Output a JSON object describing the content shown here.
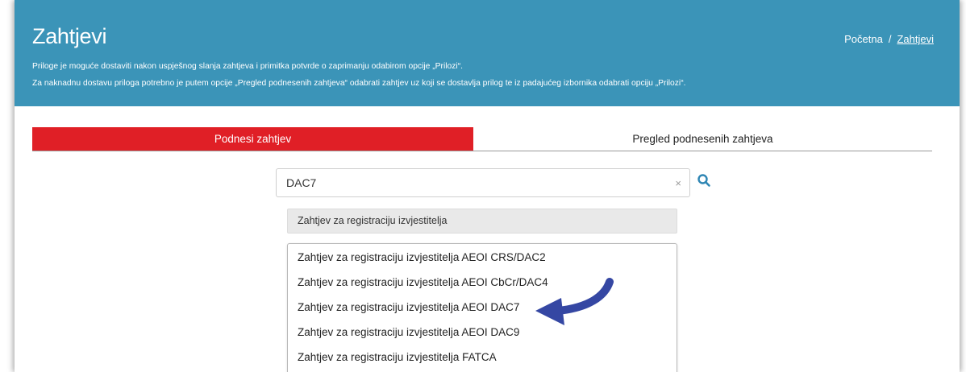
{
  "header": {
    "title": "Zahtjevi",
    "notice_line1": "Priloge je moguće dostaviti nakon uspješnog slanja zahtjeva i primitka potvrde o zaprimanju odabirom opcije „Prilozi“.",
    "notice_line2": "Za naknadnu dostavu priloga potrebno je putem opcije „Pregled podnesenih zahtjeva“ odabrati zahtjev uz koji se dostavlja prilog te iz padajućeg izbornika odabrati opciju „Prilozi“.",
    "background_color": "#3b94b8"
  },
  "breadcrumb": {
    "home": "Početna",
    "separator": "/",
    "current": "Zahtjevi"
  },
  "tabs": [
    {
      "label": "Podnesi zahtjev",
      "active": true,
      "color": "#e01f26"
    },
    {
      "label": "Pregled podnesenih zahtjeva",
      "active": false
    }
  ],
  "search": {
    "value": "DAC7",
    "clear_symbol": "×",
    "clear_icon": "close-icon",
    "search_icon": "search-icon",
    "icon_color": "#2f86b4"
  },
  "category": {
    "label": "Zahtjev za registraciju izvjestitelja"
  },
  "dropdown": {
    "options": [
      "Zahtjev za registraciju izvjestitelja AEOI CRS/DAC2",
      "Zahtjev za registraciju izvjestitelja AEOI CbCr/DAC4",
      "Zahtjev za registraciju izvjestitelja AEOI DAC7",
      "Zahtjev za registraciju izvjestitelja AEOI DAC9",
      "Zahtjev za registraciju izvjestitelja FATCA"
    ],
    "highlighted_option": "Zahtjev za registraciju izvjestitelja AEOI DAC7"
  },
  "annotation": {
    "icon": "curved-arrow-icon",
    "color": "#3547a3"
  }
}
